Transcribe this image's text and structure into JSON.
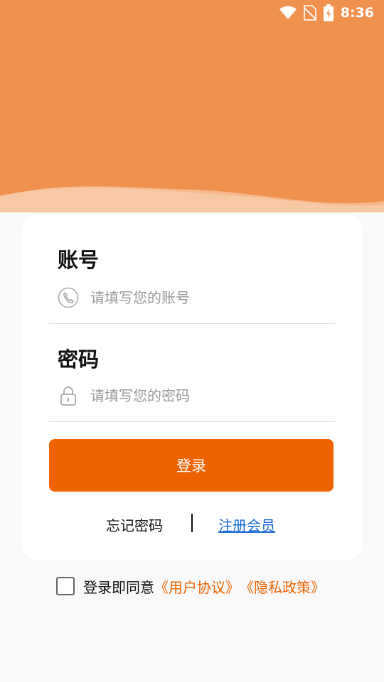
{
  "status_bar": {
    "time": "8:36",
    "icons": [
      "wifi-icon",
      "no-sim-icon",
      "battery-charging-icon"
    ]
  },
  "colors": {
    "header": "#f0914d",
    "accent": "#ec6300",
    "link": "#1a66d0"
  },
  "form": {
    "account_label": "账号",
    "account_placeholder": "请填写您的账号",
    "account_icon": "phone-icon",
    "password_label": "密码",
    "password_placeholder": "请填写您的密码",
    "password_icon": "lock-icon",
    "login_button": "登录",
    "forgot_password": "忘记密码",
    "register": "注册会员"
  },
  "agreement": {
    "checked": false,
    "text": "登录即同意",
    "user_agreement": "《用户协议》",
    "privacy_policy": "《隐私政策》"
  }
}
